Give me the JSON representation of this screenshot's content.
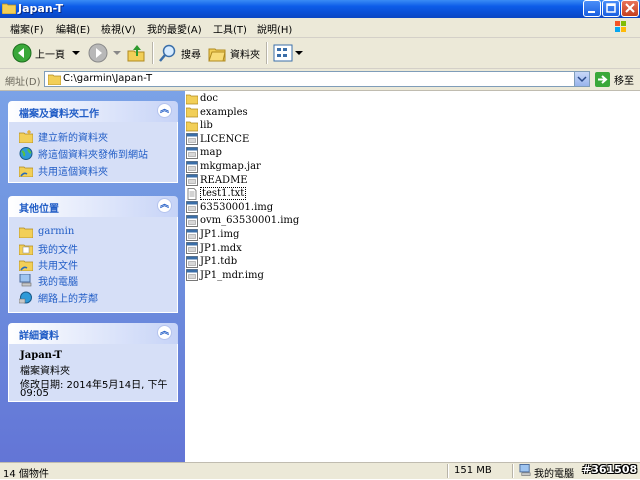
{
  "window": {
    "title": "Japan-T"
  },
  "menu": [
    "檔案(F)",
    "編輯(E)",
    "檢視(V)",
    "我的最愛(A)",
    "工具(T)",
    "說明(H)"
  ],
  "toolbar": {
    "back": "上一頁",
    "search": "搜尋",
    "folders": "資料夾"
  },
  "address": {
    "label": "網址(D)",
    "path": "C:\\garmin\\Japan-T",
    "go": "移至"
  },
  "tasks_panel": {
    "title": "檔案及資料夾工作",
    "items": [
      "建立新的資料夾",
      "將這個資料夾發佈到網站",
      "共用這個資料夾"
    ]
  },
  "places_panel": {
    "title": "其他位置",
    "items": [
      "garmin",
      "我的文件",
      "共用文件",
      "我的電腦",
      "網路上的芳鄰"
    ]
  },
  "details_panel": {
    "title": "詳細資料",
    "name": "Japan-T",
    "type": "檔案資料夾",
    "modified": "修改日期: 2014年5月14日, 下午",
    "modified_time": "09:05"
  },
  "files": [
    {
      "name": "doc",
      "kind": "folder"
    },
    {
      "name": "examples",
      "kind": "folder"
    },
    {
      "name": "lib",
      "kind": "folder"
    },
    {
      "name": "LICENCE",
      "kind": "file"
    },
    {
      "name": "map",
      "kind": "file"
    },
    {
      "name": "mkgmap.jar",
      "kind": "file"
    },
    {
      "name": "README",
      "kind": "file"
    },
    {
      "name": "test1.txt",
      "kind": "text"
    },
    {
      "name": "63530001.img",
      "kind": "file"
    },
    {
      "name": "ovm_63530001.img",
      "kind": "file"
    },
    {
      "name": "JP1.img",
      "kind": "file"
    },
    {
      "name": "JP1.mdx",
      "kind": "file"
    },
    {
      "name": "JP1.tdb",
      "kind": "file"
    },
    {
      "name": "JP1_mdr.img",
      "kind": "file"
    }
  ],
  "status": {
    "count": "14 個物件",
    "size": "151 MB",
    "location": "我的電腦",
    "watermark": "#361508"
  }
}
